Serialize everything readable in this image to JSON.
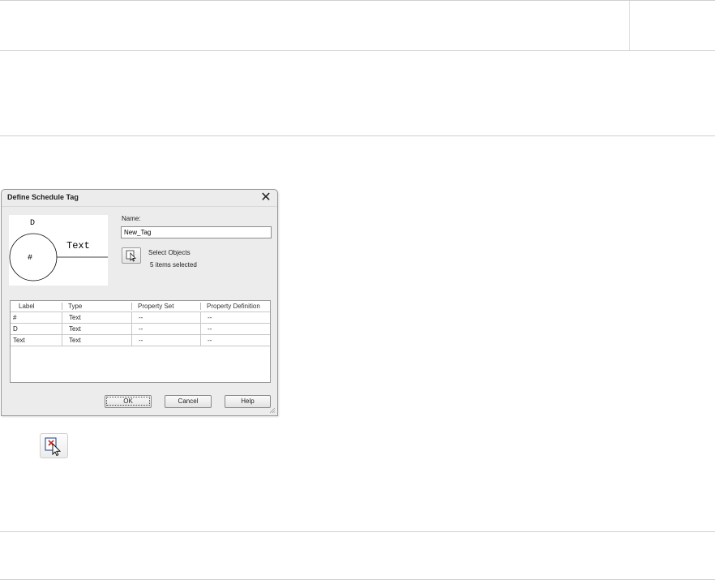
{
  "dialog": {
    "title": "Define Schedule Tag",
    "close_glyph": "✕",
    "preview": {
      "top_label": "D",
      "circle_label": "#",
      "line_label": "Text"
    },
    "name_label": "Name:",
    "name_value": "New_Tag",
    "select_objects_label": "Select Objects",
    "selected_count": "5 items selected",
    "table": {
      "headers": [
        "Label",
        "Type",
        "Property Set",
        "Property Definition"
      ],
      "rows": [
        [
          "#",
          "Text",
          "--",
          "--"
        ],
        [
          "D",
          "Text",
          "--",
          "--"
        ],
        [
          "Text",
          "Text",
          "--",
          "--"
        ]
      ]
    },
    "buttons": {
      "ok": "OK",
      "cancel": "Cancel",
      "help": "Help"
    }
  },
  "icons": {
    "select_objects": "select-objects-icon",
    "standalone": "select-objects-icon"
  }
}
